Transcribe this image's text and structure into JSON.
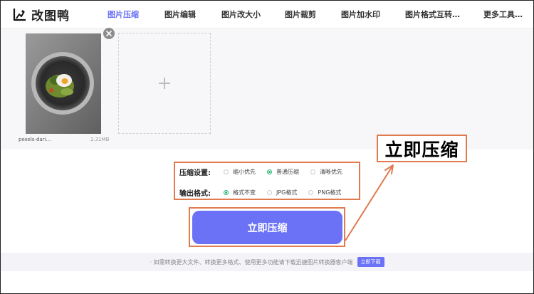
{
  "app": {
    "logo_text": "改图鸭"
  },
  "nav": {
    "items": [
      {
        "label": "图片压缩"
      },
      {
        "label": "图片编辑"
      },
      {
        "label": "图片改大小"
      },
      {
        "label": "图片裁剪"
      },
      {
        "label": "图片加水印"
      },
      {
        "label": "图片格式互转…"
      },
      {
        "label": "更多工具…"
      }
    ],
    "active": "图片压缩"
  },
  "upload": {
    "file_name": "pexels-dari…",
    "file_size": "2.31MB",
    "add_icon": "plus-icon",
    "remove_icon": "close-icon"
  },
  "settings": {
    "compress": {
      "label": "压缩设置:",
      "options": [
        {
          "label": "缩小优先",
          "selected": false
        },
        {
          "label": "普通压缩",
          "selected": true
        },
        {
          "label": "清晰优先",
          "selected": false
        }
      ]
    },
    "format": {
      "label": "输出格式:",
      "options": [
        {
          "label": "格式不变",
          "selected": true
        },
        {
          "label": "JPG格式",
          "selected": false
        },
        {
          "label": "PNG格式",
          "selected": false
        }
      ]
    }
  },
  "action": {
    "compress_label": "立即压缩"
  },
  "callout": {
    "text": "立即压缩"
  },
  "footer": {
    "note": "· 如需转换更大文件、转换更多格式、使用更多功能请下载迅捷图片转换器客户端",
    "download_label": "立即下载"
  },
  "colors": {
    "accent": "#6b72f6",
    "highlight": "#e07a4f",
    "radio_on": "#22b573"
  }
}
